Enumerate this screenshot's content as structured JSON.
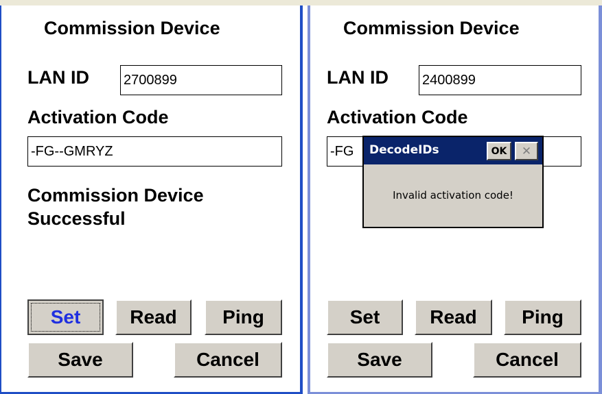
{
  "left_screen": {
    "title": "Commission Device",
    "lan_label": "LAN ID",
    "lan_value": "2700899",
    "activation_label": "Activation Code",
    "activation_value": "-FG--GMRYZ",
    "status_line1": "Commission Device",
    "status_line2": "Successful",
    "buttons": {
      "set": "Set",
      "read": "Read",
      "ping": "Ping",
      "save": "Save",
      "cancel": "Cancel"
    },
    "focused_button": "Set",
    "focus_color": "#1f2fe0"
  },
  "right_screen": {
    "title": "Commission Device",
    "lan_label": "LAN ID",
    "lan_value": "2400899",
    "activation_label": "Activation Code",
    "activation_value": "-FG",
    "buttons": {
      "set": "Set",
      "read": "Read",
      "ping": "Ping",
      "save": "Save",
      "cancel": "Cancel"
    }
  },
  "dialog": {
    "title": "DecodeIDs",
    "ok_label": "OK",
    "close_icon": "close-icon",
    "message": "Invalid activation code!",
    "title_bar_color": "#0a246a"
  },
  "colors": {
    "left_frame": "#1f4ec5",
    "right_frame": "#7b8fd8",
    "button_face": "#d4d0c8"
  }
}
